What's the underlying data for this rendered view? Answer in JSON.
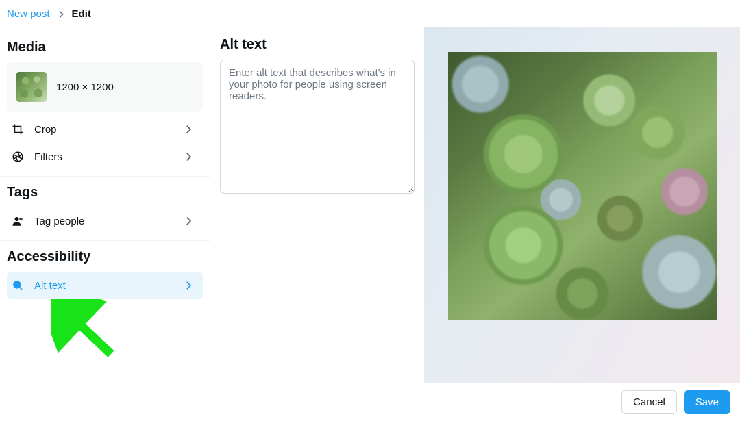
{
  "breadcrumb": {
    "parent": "New post",
    "current": "Edit"
  },
  "sidebar": {
    "media": {
      "title": "Media",
      "dimensions": "1200 × 1200",
      "crop_label": "Crop",
      "filters_label": "Filters"
    },
    "tags": {
      "title": "Tags",
      "tag_people_label": "Tag people"
    },
    "accessibility": {
      "title": "Accessibility",
      "alt_text_label": "Alt text"
    }
  },
  "center": {
    "title": "Alt text",
    "placeholder": "Enter alt text that describes what's in your photo for people using screen readers."
  },
  "footer": {
    "cancel_label": "Cancel",
    "save_label": "Save"
  }
}
